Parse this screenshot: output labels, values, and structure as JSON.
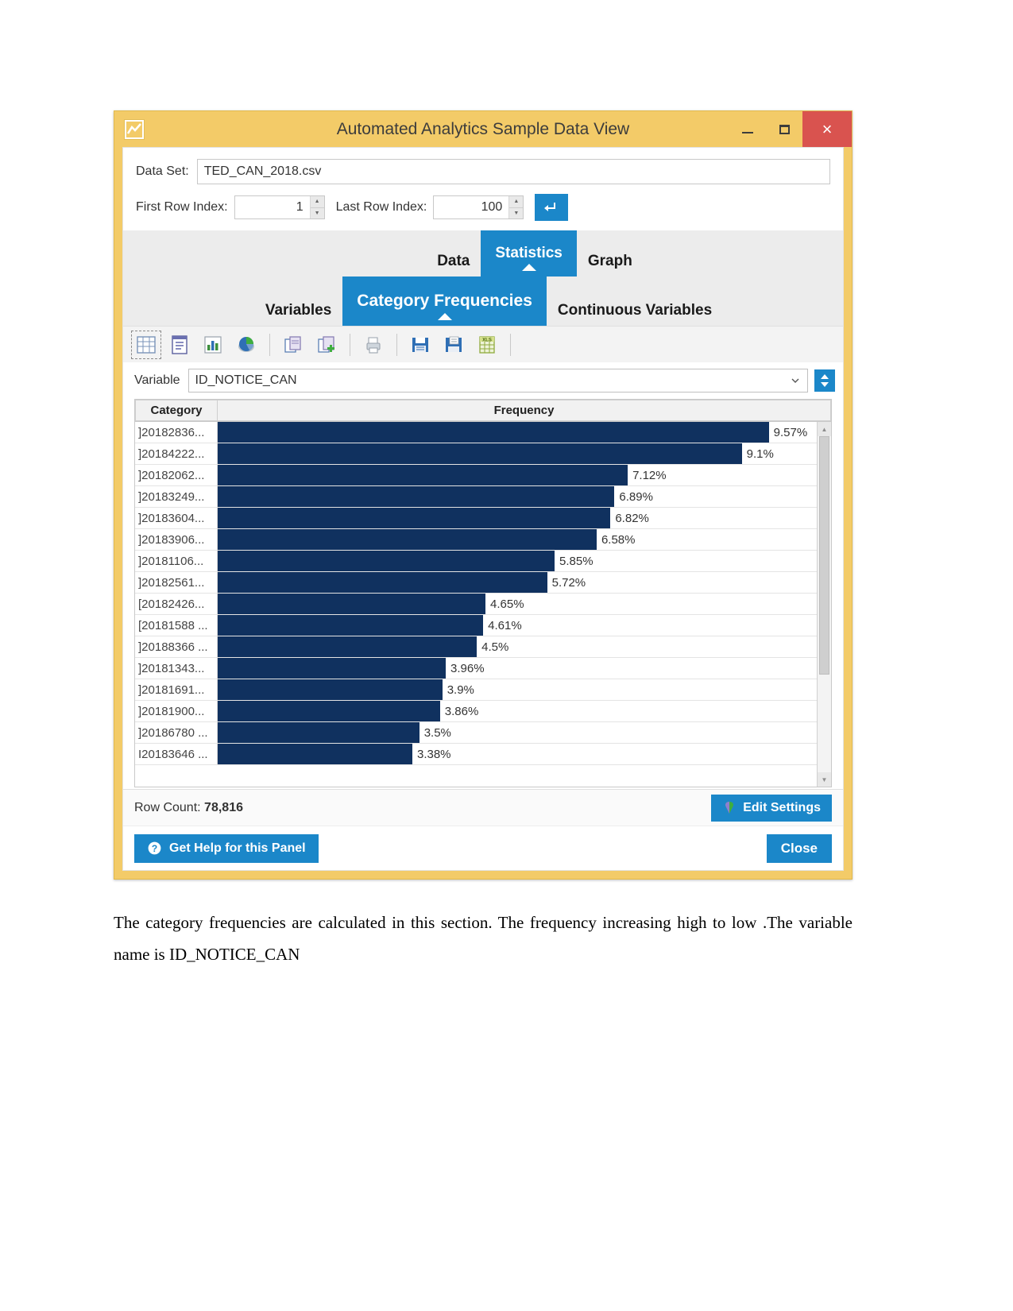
{
  "window": {
    "title": "Automated Analytics Sample Data View",
    "app_icon": "chart-icon",
    "minimize_label": "–",
    "maximize_label": "☐",
    "close_label": "×"
  },
  "dataset": {
    "label": "Data Set:",
    "value": "TED_CAN_2018.csv"
  },
  "row_index": {
    "first_label": "First Row Index:",
    "first_value": "1",
    "last_label": "Last Row Index:",
    "last_value": "100",
    "refresh_icon": "refresh-arrow-icon"
  },
  "tabs": {
    "primary": [
      {
        "label": "Data",
        "active": false
      },
      {
        "label": "Statistics",
        "active": true
      },
      {
        "label": "Graph",
        "active": false
      }
    ],
    "secondary": [
      {
        "label": "Variables",
        "active": false
      },
      {
        "label": "Category Frequencies",
        "active": true
      },
      {
        "label": "Continuous Variables",
        "active": false
      }
    ]
  },
  "toolbar": {
    "items": [
      {
        "name": "grid-table-icon",
        "selected": true
      },
      {
        "name": "report-document-icon",
        "selected": false
      },
      {
        "name": "bar-chart-icon",
        "selected": false
      },
      {
        "name": "pie-chart-icon",
        "selected": false
      },
      {
        "name": "copy-document-icon",
        "selected": false
      },
      {
        "name": "add-document-icon",
        "selected": false
      },
      {
        "name": "print-icon",
        "selected": false
      },
      {
        "name": "save-icon",
        "selected": false
      },
      {
        "name": "save-as-icon",
        "selected": false
      },
      {
        "name": "export-xls-icon",
        "selected": false
      }
    ]
  },
  "variable": {
    "label": "Variable",
    "value": "ID_NOTICE_CAN",
    "dropdown_icon": "chevron-down-icon",
    "sort_icon": "sort-updown-icon"
  },
  "table": {
    "headers": {
      "category": "Category",
      "frequency": "Frequency"
    },
    "scrollbar": {
      "up": "▲",
      "down": "▼"
    }
  },
  "footer": {
    "row_count_label": "Row Count:",
    "row_count_value": "78,816",
    "edit_settings_label": "Edit Settings",
    "edit_settings_icon": "settings-bulb-icon",
    "help_label": "Get Help for this Panel",
    "help_icon": "question-circle-icon",
    "close_label": "Close"
  },
  "caption": "The category frequencies are calculated in this section. The frequency increasing high to low .The variable name is ID_NOTICE_CAN",
  "colors": {
    "title_bar": "#f3cb68",
    "accent_blue": "#1b87c9",
    "bar_navy": "#10315f",
    "close_red": "#d9534f"
  },
  "chart_data": {
    "type": "bar",
    "title": "Category Frequencies",
    "xlabel": "Frequency",
    "ylabel": "Category",
    "variable": "ID_NOTICE_CAN",
    "units": "percent",
    "orientation": "horizontal",
    "grid": false,
    "legend": "none",
    "xlim": [
      0,
      10
    ],
    "categories": [
      "]20182836...",
      "]20184222...",
      "]20182062...",
      "]20183249...",
      "]20183604...",
      "]20183906...",
      "]20181106...",
      "]20182561...",
      "[20182426...",
      "[20181588 ...",
      "]20188366 ...",
      "]20181343...",
      "]20181691...",
      "]20181900...",
      "]20186780 ...",
      "I20183646 ..."
    ],
    "values": [
      9.57,
      9.1,
      7.12,
      6.89,
      6.82,
      6.58,
      5.85,
      5.72,
      4.65,
      4.61,
      4.5,
      3.96,
      3.9,
      3.86,
      3.5,
      3.38
    ],
    "labels": [
      "9.57%",
      "9.1%",
      "7.12%",
      "6.89%",
      "6.82%",
      "6.58%",
      "5.85%",
      "5.72%",
      "4.65%",
      "4.61%",
      "4.5%",
      "3.96%",
      "3.9%",
      "3.86%",
      "3.5%",
      "3.38%"
    ]
  }
}
